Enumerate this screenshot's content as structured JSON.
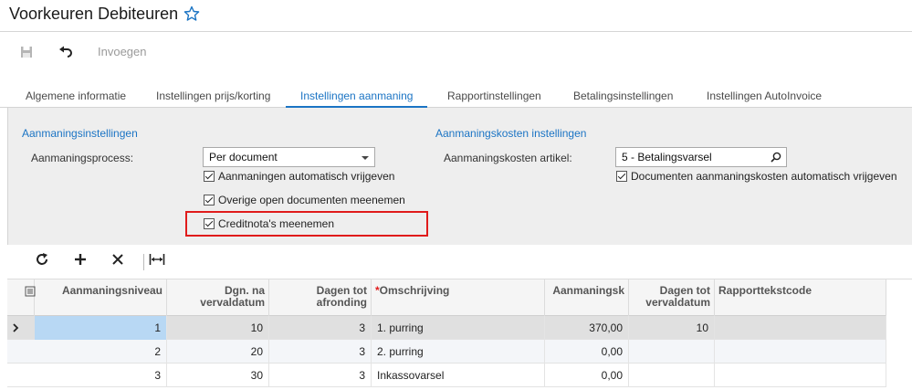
{
  "page": {
    "title": "Voorkeuren Debiteuren"
  },
  "toolbar": {
    "insert_label": "Invoegen"
  },
  "tabs": [
    {
      "label": "Algemene informatie"
    },
    {
      "label": "Instellingen prijs/korting"
    },
    {
      "label": "Instellingen aanmaning"
    },
    {
      "label": "Rapportinstellingen"
    },
    {
      "label": "Betalingsinstellingen"
    },
    {
      "label": "Instellingen AutoInvoice"
    }
  ],
  "active_tab": "Instellingen aanmaning",
  "dunning_settings": {
    "title": "Aanmaningsinstellingen",
    "process_label": "Aanmaningsprocess:",
    "process_value": "Per document",
    "checkboxes": [
      {
        "label": "Aanmaningen automatisch vrijgeven",
        "checked": true
      },
      {
        "label": "Overige open documenten meenemen",
        "checked": true
      },
      {
        "label": "Creditnota's meenemen",
        "checked": true
      }
    ]
  },
  "dunning_costs": {
    "title": "Aanmaningskosten instellingen",
    "item_label": "Aanmaningskosten artikel:",
    "item_value": "5 - Betalingsvarsel",
    "checkbox": {
      "label": "Documenten aanmaningskosten automatisch vrijgeven",
      "checked": true
    }
  },
  "grid": {
    "columns": [
      {
        "label": "Aanmaningsniveau",
        "line2": ""
      },
      {
        "label": "Dgn. na",
        "line2": "vervaldatum"
      },
      {
        "label": "Dagen tot",
        "line2": "afronding"
      },
      {
        "label": "Omschrijving",
        "line2": "",
        "required": true
      },
      {
        "label": "Aanmaningsk",
        "line2": ""
      },
      {
        "label": "Dagen tot",
        "line2": "vervaldatum"
      },
      {
        "label": "Rapporttekstcode",
        "line2": ""
      }
    ],
    "rows": [
      {
        "level": "1",
        "days_after": "10",
        "days_to_round": "3",
        "description": "1. purring",
        "cost": "370,00",
        "days_to_due": "10",
        "report_code": ""
      },
      {
        "level": "2",
        "days_after": "20",
        "days_to_round": "3",
        "description": "2. purring",
        "cost": "0,00",
        "days_to_due": "",
        "report_code": ""
      },
      {
        "level": "3",
        "days_after": "30",
        "days_to_round": "3",
        "description": "Inkassovarsel",
        "cost": "0,00",
        "days_to_due": "",
        "report_code": ""
      }
    ]
  },
  "colors": {
    "accent": "#1b74c4",
    "highlight": "#e01b1b",
    "selected_cell": "#b8d8f4"
  }
}
